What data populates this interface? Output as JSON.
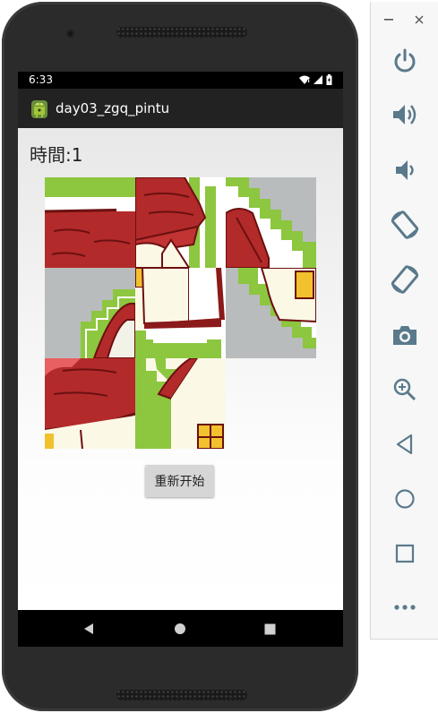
{
  "status_bar": {
    "time": "6:33"
  },
  "app_bar": {
    "title": "day03_zgq_pintu"
  },
  "game": {
    "timer_label": "時間:1",
    "restart_label": "重新开始",
    "tiles": [
      {
        "row": 0,
        "col": 0,
        "piece": "roof-left-top"
      },
      {
        "row": 0,
        "col": 1,
        "piece": "roof-chimney"
      },
      {
        "row": 0,
        "col": 2,
        "piece": "roof-right-top"
      },
      {
        "row": 1,
        "col": 0,
        "piece": "roof-left-edge"
      },
      {
        "row": 1,
        "col": 1,
        "piece": "window-center"
      },
      {
        "row": 1,
        "col": 2,
        "piece": "wall-right"
      },
      {
        "row": 2,
        "col": 0,
        "piece": "roof-bottom-left"
      },
      {
        "row": 2,
        "col": 1,
        "piece": "wall-bottom-center"
      },
      {
        "row": 2,
        "col": 2,
        "piece": "empty"
      }
    ]
  },
  "toolbar": {
    "minimize_icon": "minimize-icon",
    "close_icon": "close-icon",
    "buttons": [
      "power-icon",
      "volume-up-icon",
      "volume-down-icon",
      "rotate-left-icon",
      "rotate-right-icon",
      "camera-icon",
      "zoom-icon",
      "back-icon",
      "home-icon",
      "overview-icon",
      "more-icon"
    ]
  },
  "colors": {
    "roof_red": "#b32a2a",
    "grass_green": "#8dc63f",
    "sky_gray": "#b9bcbd",
    "wall_cream": "#fcf8e6",
    "window_yellow": "#f2c12e"
  }
}
